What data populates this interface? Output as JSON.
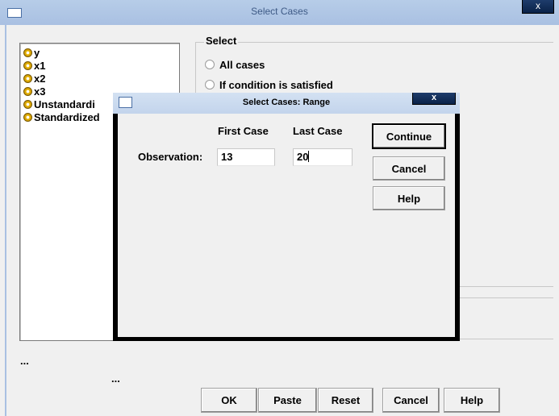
{
  "main_window": {
    "title": "Select Cases",
    "close_label": "x",
    "variables": [
      {
        "label": "y",
        "icon": "scale-variable-icon"
      },
      {
        "label": "x1",
        "icon": "scale-variable-icon"
      },
      {
        "label": "x2",
        "icon": "scale-variable-icon"
      },
      {
        "label": "x3",
        "icon": "scale-variable-icon"
      },
      {
        "label": "Unstandardi",
        "icon": "scale-variable-icon"
      },
      {
        "label": "Standardized",
        "icon": "scale-variable-icon"
      }
    ],
    "select_group": {
      "legend": "Select",
      "options": [
        "All cases",
        "If condition is satisfied"
      ]
    },
    "ellipsis_1": "...",
    "ellipsis_2": "...",
    "buttons": {
      "ok": "OK",
      "paste": "Paste",
      "reset": "Reset",
      "cancel": "Cancel",
      "help": "Help"
    }
  },
  "range_dialog": {
    "title": "Select Cases: Range",
    "close_label": "x",
    "first_case_header": "First Case",
    "last_case_header": "Last Case",
    "observation_label": "Observation:",
    "first_case_value": "13",
    "last_case_value": "20",
    "buttons": {
      "continue": "Continue",
      "cancel": "Cancel",
      "help": "Help"
    }
  }
}
